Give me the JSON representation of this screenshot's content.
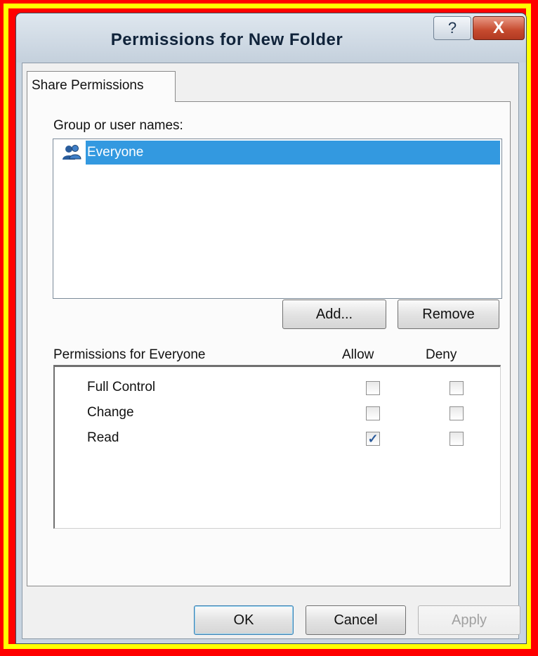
{
  "dialog": {
    "title": "Permissions for New Folder",
    "help_label": "?",
    "close_label": "X"
  },
  "tab": {
    "label": "Share Permissions"
  },
  "users": {
    "label": "Group or user names:",
    "items": [
      {
        "name": "Everyone",
        "icon": "users-group-icon",
        "selected": true
      }
    ]
  },
  "buttons": {
    "add": "Add...",
    "remove": "Remove",
    "ok": "OK",
    "cancel": "Cancel",
    "apply": "Apply"
  },
  "permissions": {
    "label": "Permissions for Everyone",
    "allow_header": "Allow",
    "deny_header": "Deny",
    "rows": [
      {
        "name": "Full Control",
        "allow": false,
        "deny": false
      },
      {
        "name": "Change",
        "allow": false,
        "deny": false
      },
      {
        "name": "Read",
        "allow": true,
        "deny": false
      }
    ]
  },
  "colors": {
    "selection": "#3399e0",
    "outer_frame": "#ff0000",
    "inner_frame": "#ffff00"
  }
}
